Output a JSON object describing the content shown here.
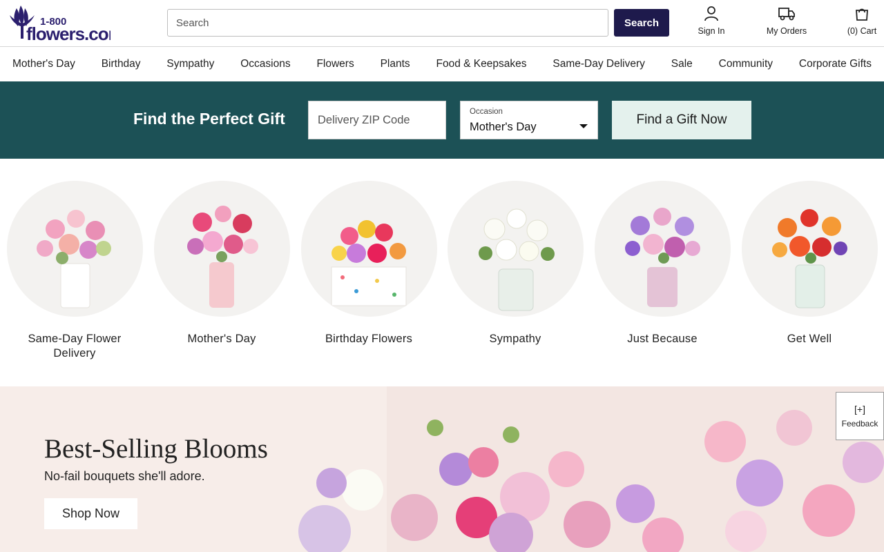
{
  "header": {
    "logo_text_top": "1-800",
    "logo_text_main": "flowers.com",
    "search_placeholder": "Search",
    "search_button": "Search",
    "sign_in": "Sign In",
    "my_orders": "My Orders",
    "cart": "(0) Cart"
  },
  "nav": {
    "items": [
      "Mother's Day",
      "Birthday",
      "Sympathy",
      "Occasions",
      "Flowers",
      "Plants",
      "Food & Keepsakes",
      "Same-Day Delivery",
      "Sale",
      "Community",
      "Corporate Gifts"
    ]
  },
  "finder": {
    "title": "Find the Perfect Gift",
    "zip_placeholder": "Delivery ZIP Code",
    "occasion_label": "Occasion",
    "occasion_value": "Mother's Day",
    "button": "Find a Gift Now"
  },
  "categories": [
    {
      "label": "Same-Day Flower Delivery"
    },
    {
      "label": "Mother's Day"
    },
    {
      "label": "Birthday Flowers"
    },
    {
      "label": "Sympathy"
    },
    {
      "label": "Just Because"
    },
    {
      "label": "Get Well"
    }
  ],
  "hero": {
    "title": "Best-Selling Blooms",
    "subtitle": "No-fail bouquets she'll adore.",
    "button": "Shop Now"
  },
  "feedback": {
    "icon_text": "[+]",
    "label": "Feedback"
  },
  "colors": {
    "brand_navy": "#1e1a4c",
    "finder_teal": "#1c5156",
    "find_button_bg": "#e4f1ed",
    "hero_bg": "#f7ede9"
  }
}
